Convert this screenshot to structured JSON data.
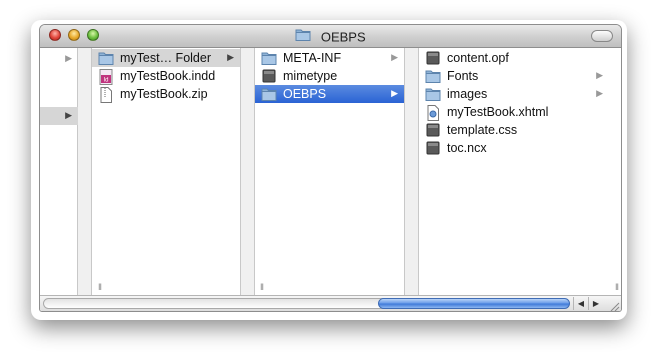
{
  "window": {
    "title": "OEBPS"
  },
  "columns": [
    {
      "items": [
        {
          "label": "",
          "arrow": "▶",
          "selected": "none"
        },
        {
          "label": "",
          "arrow": "",
          "selected": "none"
        },
        {
          "label": "",
          "arrow": "▶",
          "selected": "gray"
        }
      ]
    },
    {
      "items": [
        {
          "label": "myTest… Folder",
          "icon": "folder-icon",
          "arrow": "▶",
          "selected": "gray"
        },
        {
          "label": "myTestBook.indd",
          "icon": "indesign-file-icon",
          "arrow": "",
          "selected": "none"
        },
        {
          "label": "myTestBook.zip",
          "icon": "zip-file-icon",
          "arrow": "",
          "selected": "none"
        }
      ]
    },
    {
      "items": [
        {
          "label": "META-INF",
          "icon": "folder-icon",
          "arrow": "▶",
          "selected": "none"
        },
        {
          "label": "mimetype",
          "icon": "generic-file-icon",
          "arrow": "",
          "selected": "none"
        },
        {
          "label": "OEBPS",
          "icon": "folder-icon",
          "arrow": "▶",
          "selected": "blue"
        }
      ]
    },
    {
      "items": [
        {
          "label": "content.opf",
          "icon": "generic-file-icon",
          "arrow": "",
          "selected": "none"
        },
        {
          "label": "Fonts",
          "icon": "folder-icon",
          "arrow": "▶",
          "selected": "none"
        },
        {
          "label": "images",
          "icon": "folder-icon",
          "arrow": "▶",
          "selected": "none"
        },
        {
          "label": "myTestBook.xhtml",
          "icon": "xhtml-file-icon",
          "arrow": "",
          "selected": "none"
        },
        {
          "label": "template.css",
          "icon": "generic-file-icon",
          "arrow": "",
          "selected": "none"
        },
        {
          "label": "toc.ncx",
          "icon": "generic-file-icon",
          "arrow": "",
          "selected": "none"
        }
      ]
    }
  ],
  "scrollbar": {
    "left_arrow": "◀",
    "right_arrow": "▶"
  },
  "column_grip": "II",
  "colors": {
    "selection_blue": "#2a63d4",
    "selection_gray": "#d6d6d6"
  }
}
